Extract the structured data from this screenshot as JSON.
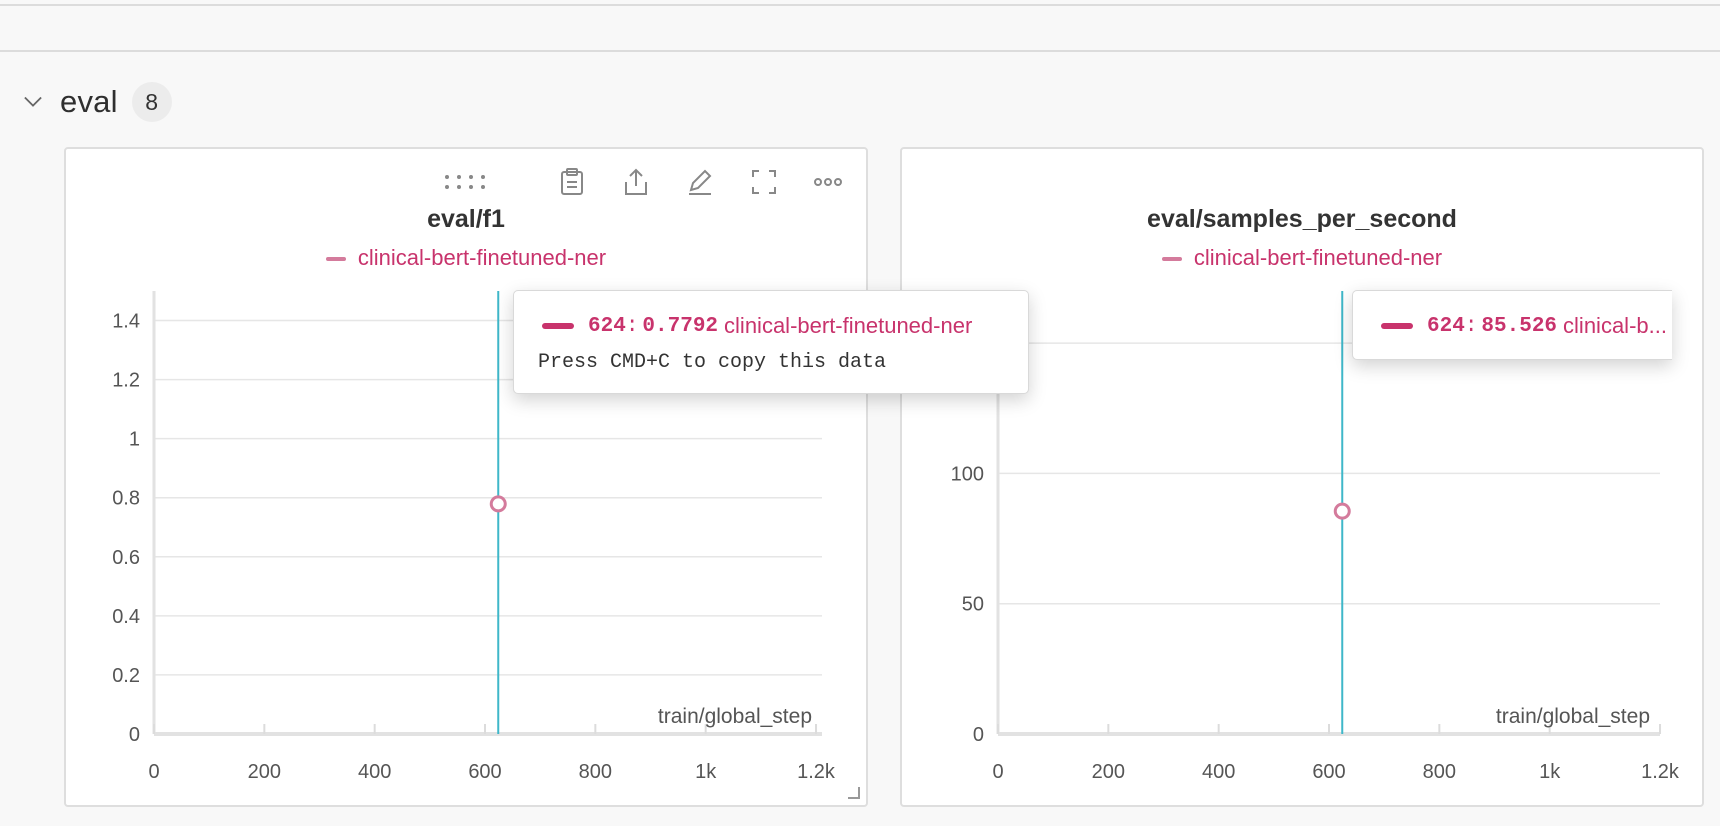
{
  "section": {
    "title": "eval",
    "count": "8"
  },
  "toolbar_icons": [
    "drag-handle-icon",
    "clipboard-icon",
    "share-icon",
    "edit-icon",
    "fullscreen-icon",
    "more-icon"
  ],
  "colors": {
    "series": "#c8336c",
    "series_light": "#d47b9c",
    "cursor": "#3fb7c9"
  },
  "panels": [
    {
      "title": "eval/f1",
      "legend_label": "clinical-bert-finetuned-ner",
      "tooltip": {
        "step": "624",
        "value": "0.7792",
        "run": "clinical-bert-finetuned-ner",
        "hint": "Press CMD+C to copy this data"
      }
    },
    {
      "title": "eval/samples_per_second",
      "legend_label": "clinical-bert-finetuned-ner",
      "tooltip": {
        "step": "624",
        "value": "85.526",
        "run": "clinical-b..."
      }
    }
  ],
  "chart_data": [
    {
      "type": "scatter",
      "title": "eval/f1",
      "xlabel": "train/global_step",
      "ylabel": "",
      "xlim": [
        0,
        1250
      ],
      "ylim": [
        0,
        1.5
      ],
      "x_ticks": [
        0,
        200,
        400,
        600,
        800,
        1000,
        1200
      ],
      "x_tick_labels": [
        "0",
        "200",
        "400",
        "600",
        "800",
        "1k",
        "1.2k"
      ],
      "y_ticks": [
        0,
        0.2,
        0.4,
        0.6,
        0.8,
        1,
        1.2,
        1.4
      ],
      "y_tick_labels": [
        "0",
        "0.2",
        "0.4",
        "0.6",
        "0.8",
        "1",
        "1.2",
        "1.4"
      ],
      "grid": true,
      "legend_position": "top",
      "cursor_x": 624,
      "series": [
        {
          "name": "clinical-bert-finetuned-ner",
          "x": [
            624
          ],
          "y": [
            0.7792
          ]
        }
      ]
    },
    {
      "type": "scatter",
      "title": "eval/samples_per_second",
      "xlabel": "train/global_step",
      "ylabel": "",
      "xlim": [
        0,
        1250
      ],
      "ylim": [
        0,
        170
      ],
      "x_ticks": [
        0,
        200,
        400,
        600,
        800,
        1000,
        1200
      ],
      "x_tick_labels": [
        "0",
        "200",
        "400",
        "600",
        "800",
        "1k",
        "1.2k"
      ],
      "y_ticks": [
        0,
        50,
        100,
        150
      ],
      "y_tick_labels": [
        "0",
        "50",
        "100",
        ""
      ],
      "grid": true,
      "legend_position": "top",
      "cursor_x": 624,
      "series": [
        {
          "name": "clinical-bert-finetuned-ner",
          "x": [
            624
          ],
          "y": [
            85.526
          ]
        }
      ]
    }
  ]
}
